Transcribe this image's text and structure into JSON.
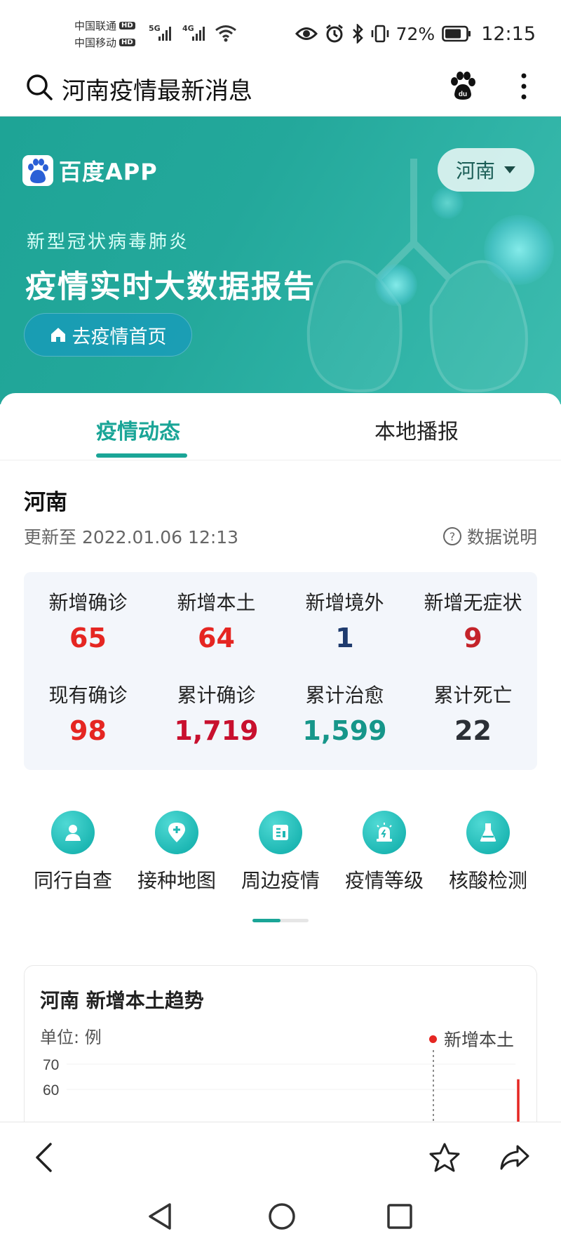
{
  "status_bar": {
    "carriers": [
      {
        "name": "中国联通",
        "badge": "HD",
        "network": "5G"
      },
      {
        "name": "中国移动",
        "badge": "HD",
        "network": "4G"
      }
    ],
    "battery": "72%",
    "time": "12:15"
  },
  "search": {
    "query": "河南疫情最新消息"
  },
  "banner": {
    "brand": "百度APP",
    "region": "河南",
    "subtitle": "新型冠状病毒肺炎",
    "title": "疫情实时大数据报告",
    "home_button": "去疫情首页"
  },
  "tabs": [
    {
      "label": "疫情动态",
      "active": true
    },
    {
      "label": "本地播报",
      "active": false
    }
  ],
  "summary": {
    "region": "河南",
    "updated": "更新至 2022.01.06 12:13",
    "data_note": "数据说明",
    "stats": [
      {
        "label": "新增确诊",
        "value": "65",
        "color": "#e52622"
      },
      {
        "label": "新增本土",
        "value": "64",
        "color": "#e52622"
      },
      {
        "label": "新增境外",
        "value": "1",
        "color": "#1f3b6e"
      },
      {
        "label": "新增无症状",
        "value": "9",
        "color": "#c4232a"
      },
      {
        "label": "现有确诊",
        "value": "98",
        "color": "#e52622"
      },
      {
        "label": "累计确诊",
        "value": "1,719",
        "color": "#c8102e"
      },
      {
        "label": "累计治愈",
        "value": "1,599",
        "color": "#16968a"
      },
      {
        "label": "累计死亡",
        "value": "22",
        "color": "#2b2f36"
      }
    ]
  },
  "tools": [
    {
      "label": "同行自查",
      "icon": "person-icon"
    },
    {
      "label": "接种地图",
      "icon": "map-pin-plus-icon"
    },
    {
      "label": "周边疫情",
      "icon": "document-chart-icon"
    },
    {
      "label": "疫情等级",
      "icon": "alarm-light-icon"
    },
    {
      "label": "核酸检测",
      "icon": "test-flask-icon"
    }
  ],
  "trend_chart": {
    "title": "河南 新增本土趋势",
    "unit": "单位: 例",
    "legend": "新增本土",
    "accent": "#e52622",
    "chart_data": {
      "type": "line",
      "title": "河南 新增本土趋势",
      "ylabel": "单位: 例",
      "series": [
        {
          "name": "新增本土",
          "values": [
            64
          ]
        }
      ],
      "y_ticks": [
        70,
        60
      ]
    }
  },
  "colors": {
    "accent": "#1aa597",
    "banner": "#23a89b"
  }
}
